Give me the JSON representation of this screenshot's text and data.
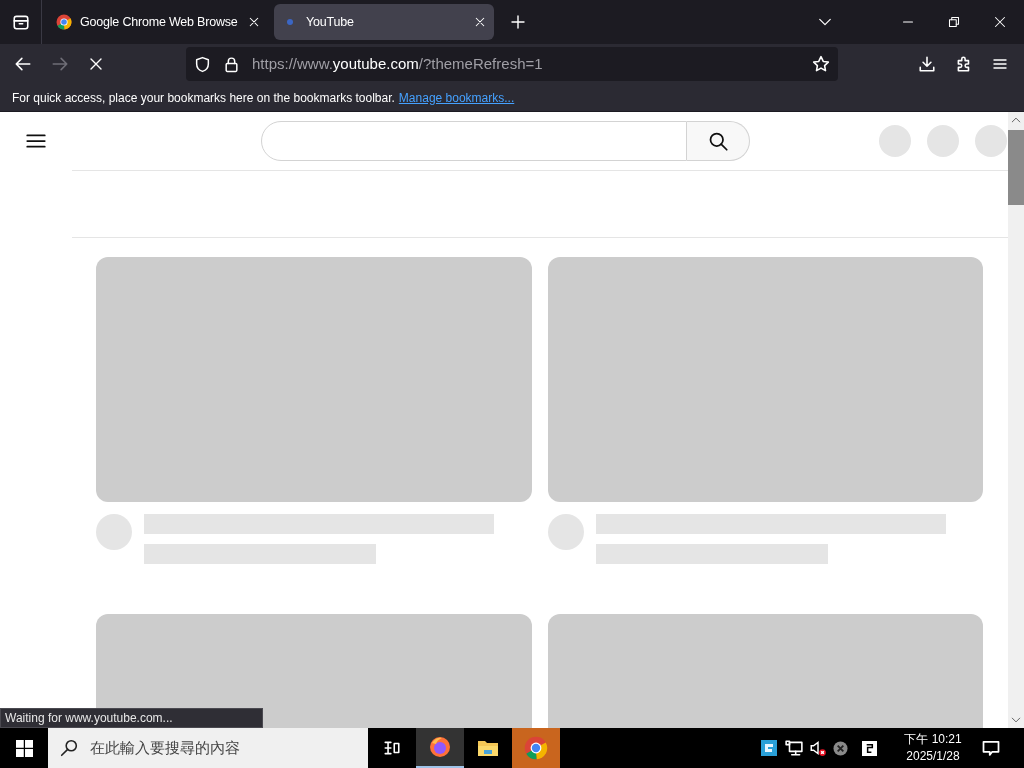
{
  "tabs": [
    {
      "title": "Google Chrome Web Browse",
      "selected": false
    },
    {
      "title": "YouTube",
      "selected": true
    }
  ],
  "address_bar": {
    "url_prefix": "https://www.",
    "url_domain": "youtube.com",
    "url_suffix": "/?themeRefresh=1"
  },
  "bookmarks_bar": {
    "message": "For quick access, place your bookmarks here on the bookmarks toolbar.",
    "link": "Manage bookmarks..."
  },
  "status_bar": {
    "text": "Waiting for www.youtube.com..."
  },
  "taskbar": {
    "search_placeholder": "在此輸入要搜尋的內容",
    "time": "下午 10:21",
    "date": "2025/1/28"
  }
}
